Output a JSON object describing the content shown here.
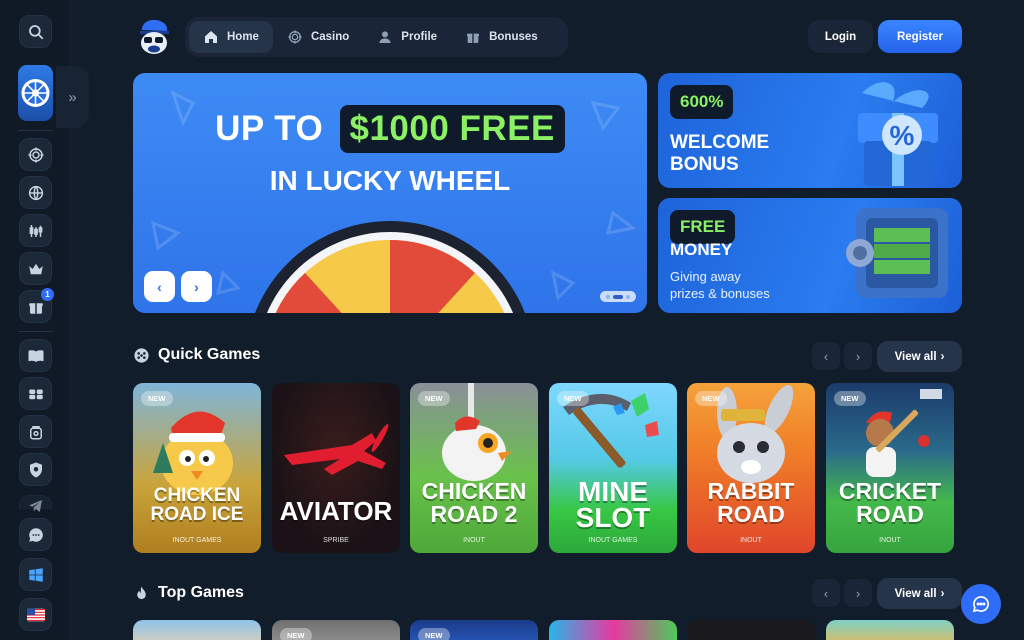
{
  "nav": {
    "items": [
      {
        "label": "Home",
        "icon": "home-icon",
        "active": true
      },
      {
        "label": "Casino",
        "icon": "casino-chip-icon",
        "active": false
      },
      {
        "label": "Profile",
        "icon": "user-icon",
        "active": false
      },
      {
        "label": "Bonuses",
        "icon": "gift-icon",
        "active": false
      }
    ],
    "login_label": "Login",
    "register_label": "Register"
  },
  "sidebar": {
    "gift_badge_count": "1",
    "icons": [
      "search-icon",
      "lucky-wheel-icon",
      "casino-chip-icon",
      "globe-icon",
      "candles-icon",
      "crown-icon",
      "gift-icon",
      "book-icon",
      "sports-icon",
      "lock-box-icon",
      "shield-icon",
      "telegram-icon",
      "chat-icon",
      "windows-icon",
      "us-flag-icon"
    ]
  },
  "hero": {
    "line1_pre": "UP TO",
    "line1_pill": "$1000 FREE",
    "line2": "IN LUCKY WHEEL",
    "prev_label": "‹",
    "next_label": "›"
  },
  "promos": [
    {
      "tag": "600%",
      "title_line1": "WELCOME",
      "title_line2": "BONUS"
    },
    {
      "tag": "FREE",
      "title_line1": "MONEY",
      "subtitle_line1": "Giving away",
      "subtitle_line2": "prizes & bonuses"
    }
  ],
  "sections": {
    "quick": {
      "title": "Quick Games",
      "view_all": "View all"
    },
    "top": {
      "title": "Top Games",
      "view_all": "View all"
    }
  },
  "quick_games": [
    {
      "new": "NEW",
      "title1": "CHICKEN",
      "title2": "ROAD ICE",
      "provider": "INOUT GAMES"
    },
    {
      "new": "",
      "title1": "AVIATOR",
      "title2": "",
      "provider": "SPRIBE"
    },
    {
      "new": "NEW",
      "title1": "CHICKEN",
      "title2": "ROAD 2",
      "provider": "INOUT"
    },
    {
      "new": "NEW",
      "title1": "MINE",
      "title2": "SLOT",
      "provider": "INOUT GAMES"
    },
    {
      "new": "NEW",
      "title1": "RABBIT",
      "title2": "ROAD",
      "provider": "INOUT"
    },
    {
      "new": "NEW",
      "title1": "CRICKET",
      "title2": "ROAD",
      "provider": "INOUT"
    }
  ],
  "top_games": [
    {
      "new": ""
    },
    {
      "new": "NEW"
    },
    {
      "new": "NEW"
    },
    {
      "new": ""
    },
    {
      "new": ""
    },
    {
      "new": ""
    }
  ],
  "colors": {
    "accent": "#2f6df6",
    "bg": "#121d2b",
    "promo_green": "#8af064"
  }
}
